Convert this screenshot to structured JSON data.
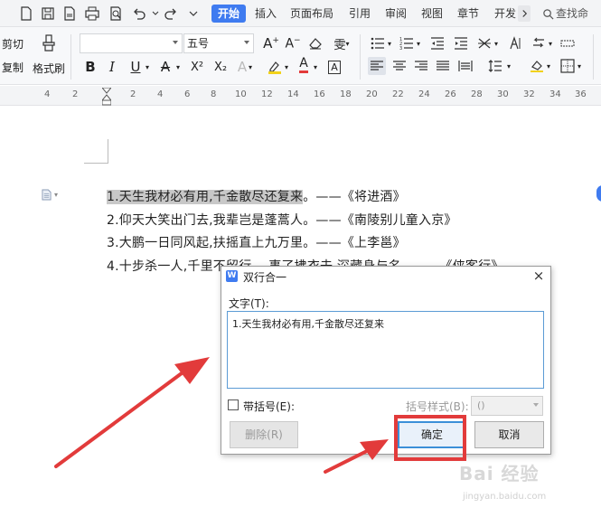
{
  "menu": {
    "tabs": [
      "开始",
      "插入",
      "页面布局",
      "引用",
      "审阅",
      "视图",
      "章节",
      "开发"
    ],
    "search_label": "查找命"
  },
  "ribbon": {
    "cut_label": "剪切",
    "copy_label": "复制",
    "format_painter_label": "格式刷",
    "font_name": "",
    "font_size": "五号",
    "bold": "B",
    "italic": "I",
    "underline": "U",
    "superscript": "X²",
    "subscript": "X₂"
  },
  "ruler": {
    "numbers": [
      "4",
      "2",
      "2",
      "4",
      "6",
      "8",
      "10",
      "12",
      "14",
      "16",
      "18",
      "20",
      "22",
      "24",
      "26",
      "28",
      "30",
      "32",
      "34",
      "36",
      "38"
    ]
  },
  "document": {
    "lines": [
      {
        "highlight": "1.天生我材必有用,千金散尽还复来",
        "rest": "。——《将进酒》"
      },
      {
        "highlight": "",
        "rest": "2.仰天大笑出门去,我辈岂是蓬蒿人。——《南陵别儿童入京》"
      },
      {
        "highlight": "",
        "rest": "3.大鹏一日同风起,扶摇直上九万里。——《上李邕》"
      },
      {
        "highlight": "",
        "rest": "4.十步杀一人,千里不留行。 事了拂衣去,深藏身与名。——《侠客行》"
      }
    ]
  },
  "dialog": {
    "title": "双行合一",
    "text_label": "文字(T):",
    "text_value": "1.天生我材必有用,千金散尽还复来",
    "bracket_checkbox_label": "带括号(E):",
    "bracket_style_label": "括号样式(B):",
    "bracket_style_value": "()",
    "delete_button": "删除(R)",
    "ok_button": "确定",
    "cancel_button": "取消"
  },
  "watermark": {
    "main": "Bai 经验",
    "sub": "jingyan.baidu.com"
  },
  "colors": {
    "accent": "#3f7bf0",
    "highlight": "#c8c8c8",
    "annotation_red": "#e23b3b",
    "dialog_focus": "#3b8fd8"
  }
}
